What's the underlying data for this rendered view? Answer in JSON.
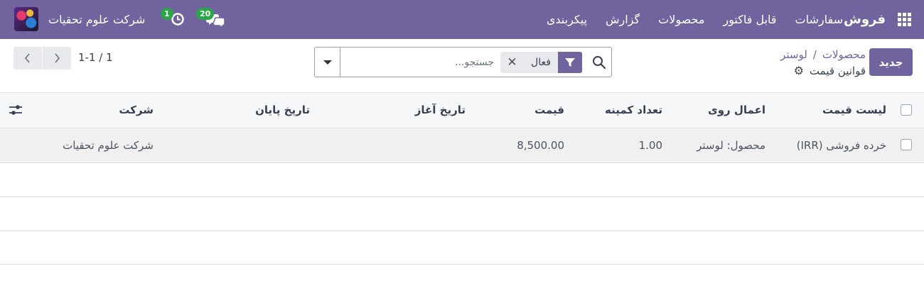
{
  "navbar": {
    "app_name": "فروش",
    "menu": [
      "سفارشات",
      "قابل فاکتور",
      "محصولات",
      "گزارش",
      "پیکربندی"
    ],
    "chat_count": "20",
    "activity_count": "1",
    "company": "شرکت علوم تحقیات",
    "accent_color": "#71639e",
    "badge_color": "#28a745"
  },
  "control": {
    "new_button": "جدید",
    "breadcrumb": [
      "محصولات",
      "لوستر"
    ],
    "breadcrumb_separator": "/",
    "title": "قوانین قیمت",
    "search_placeholder": "جستجو...",
    "facet_label": "فعال",
    "pager": "1-1 / 1"
  },
  "table": {
    "columns": [
      "لیست قیمت",
      "اعمال روی",
      "تعداد کمینه",
      "قیمت",
      "تاریخ آغاز",
      "تاریخ پایان",
      "شرکت"
    ],
    "rows": [
      {
        "pricelist": "خرده فروشی (IRR)",
        "apply_on": "محصول: لوستر",
        "min_qty": "1.00",
        "price": "8,500.00",
        "date_start": "",
        "date_end": "",
        "company": "شرکت علوم تحقیات"
      }
    ]
  },
  "icons": [
    "apps-grid-icon",
    "chat-icon",
    "activity-clock-icon",
    "company-logo",
    "gear-icon",
    "search-icon",
    "filter-icon",
    "close-icon",
    "caret-down-icon",
    "chevron-left-icon",
    "chevron-right-icon",
    "optional-columns-icon"
  ]
}
